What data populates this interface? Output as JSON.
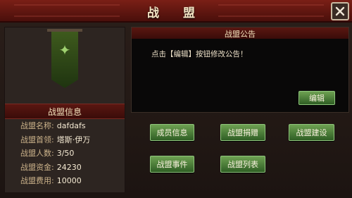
{
  "window": {
    "title": "战 盟"
  },
  "info": {
    "header": "战盟信息",
    "rows": [
      {
        "label": "战盟名称:",
        "value": "dafdafs"
      },
      {
        "label": "战盟首领:",
        "value": "塔斯·伊万"
      },
      {
        "label": "战盟人数:",
        "value": "3/50"
      },
      {
        "label": "战盟资金:",
        "value": "24230"
      },
      {
        "label": "战盟费用:",
        "value": "10000"
      }
    ]
  },
  "notice": {
    "title": "战盟公告",
    "text": "点击【编辑】按钮修改公告！",
    "edit_label": "编辑"
  },
  "actions": {
    "members": "成员信息",
    "donate": "战盟捐赠",
    "build": "战盟建设",
    "events": "战盟事件",
    "list": "战盟列表"
  },
  "icons": {
    "close": "close-icon",
    "banner": "guild-banner-icon"
  },
  "colors": {
    "title_red": "#7a1f16",
    "button_green": "#4f8a3a"
  }
}
